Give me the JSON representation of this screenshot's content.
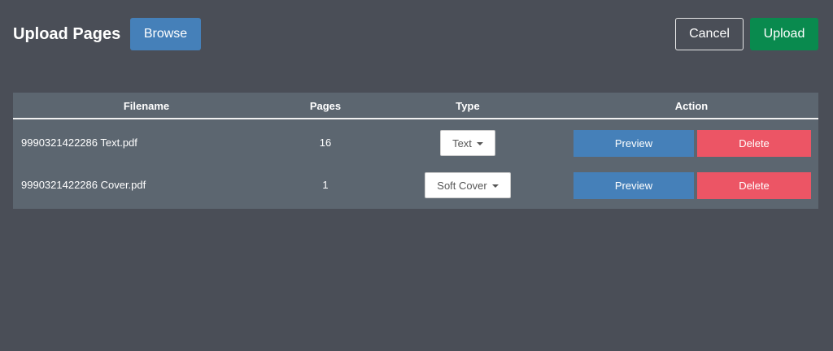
{
  "header": {
    "title": "Upload Pages",
    "browse_label": "Browse",
    "cancel_label": "Cancel",
    "upload_label": "Upload"
  },
  "table": {
    "columns": {
      "filename": "Filename",
      "pages": "Pages",
      "type": "Type",
      "action": "Action"
    },
    "rows": [
      {
        "filename": "9990321422286 Text.pdf",
        "pages": "16",
        "type": "Text",
        "preview_label": "Preview",
        "delete_label": "Delete"
      },
      {
        "filename": "9990321422286 Cover.pdf",
        "pages": "1",
        "type": "Soft Cover",
        "preview_label": "Preview",
        "delete_label": "Delete"
      }
    ]
  },
  "colors": {
    "background": "#4a4e57",
    "table_background": "#5c6670",
    "primary": "#4580b9",
    "success": "#098a4e",
    "danger": "#ec5565"
  }
}
